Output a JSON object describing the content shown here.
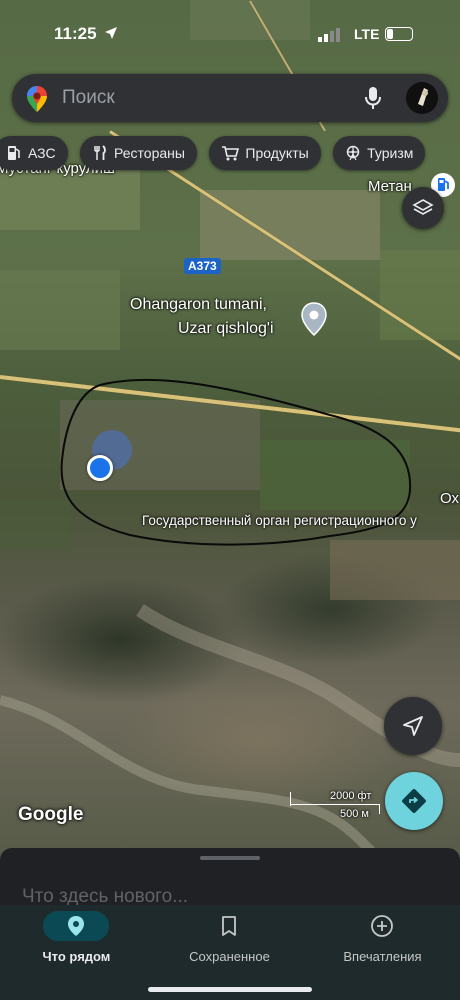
{
  "status_bar": {
    "time": "11:25",
    "network": "LTE"
  },
  "search": {
    "placeholder": "Поиск"
  },
  "chips": [
    "АЗС",
    "Рестораны",
    "Продукты",
    "Туризм"
  ],
  "map": {
    "labels": {
      "top_left": "Мустанг курулиш",
      "top_right": "Метан",
      "road": "A373",
      "place_line1": "Ohangaron tumani,",
      "place_line2": "Uzar qishlog'i",
      "gov": "Государственный орган регистрационного у",
      "edge": "Ох"
    },
    "google_logo": "Google",
    "scale": {
      "ft": "2000 фт",
      "m": "500 м"
    }
  },
  "bottom_sheet": {
    "title": "Что здесь нового..."
  },
  "nav": [
    {
      "label": "Что рядом",
      "active": true
    },
    {
      "label": "Сохраненное",
      "active": false
    },
    {
      "label": "Впечатления",
      "active": false
    }
  ],
  "colors": {
    "sheet_bg": "#202124",
    "nav_active": "#0b4a55",
    "directions_fab": "#6fd3dd",
    "location_dot": "#1a73e8"
  }
}
